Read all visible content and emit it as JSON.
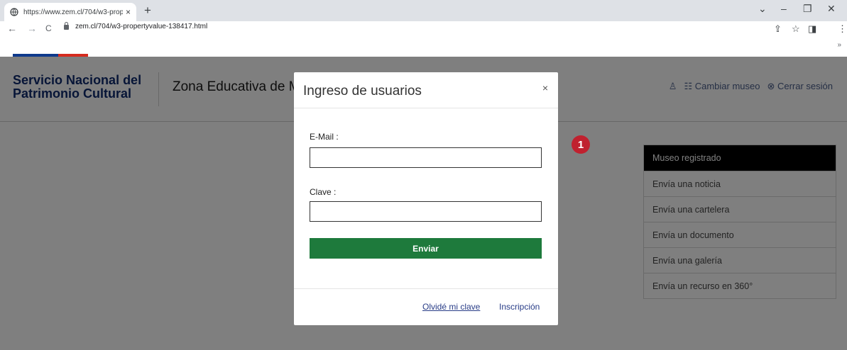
{
  "browser": {
    "tab_title": "https://www.zem.cl/704/w3-prop",
    "tab_close": "×",
    "new_tab": "+",
    "url": "zem.cl/704/w3-propertyvalue-138417.html",
    "bookmarks_more": "»",
    "controls": {
      "minimize": "–",
      "restore": "❐",
      "close": "✕",
      "tab_list": "⌄"
    },
    "nav": {
      "back": "←",
      "forward": "→",
      "reload": "C"
    },
    "toolbar_icons": {
      "share": "⇪",
      "star": "☆",
      "sidepanel": "◨",
      "menu": "⋮"
    }
  },
  "header": {
    "logo_line1": "Servicio Nacional del",
    "logo_line2": "Patrimonio Cultural",
    "zona": "Zona Educativa de Museos",
    "user_icon": "♙",
    "cambiar_museo": "☷ Cambiar museo",
    "cerrar_sesion": "⊗ Cerrar sesión"
  },
  "side_menu": [
    "Museo registrado",
    "Envía una noticia",
    "Envía una cartelera",
    "Envía un documento",
    "Envía una galería",
    "Envía un recurso en 360°"
  ],
  "badge": "1",
  "modal": {
    "title": "Ingreso de usuarios",
    "close": "×",
    "email_label": "E-Mail :",
    "email_value": "",
    "password_label": "Clave :",
    "password_value": "",
    "submit": "Enviar",
    "forgot": "Olvidé mi clave",
    "register": "Inscripción"
  },
  "colors": {
    "primary_green": "#1e7a3c",
    "link_blue": "#283c87",
    "badge_red": "#c0212f",
    "logo_blue": "#0f2a6e"
  }
}
